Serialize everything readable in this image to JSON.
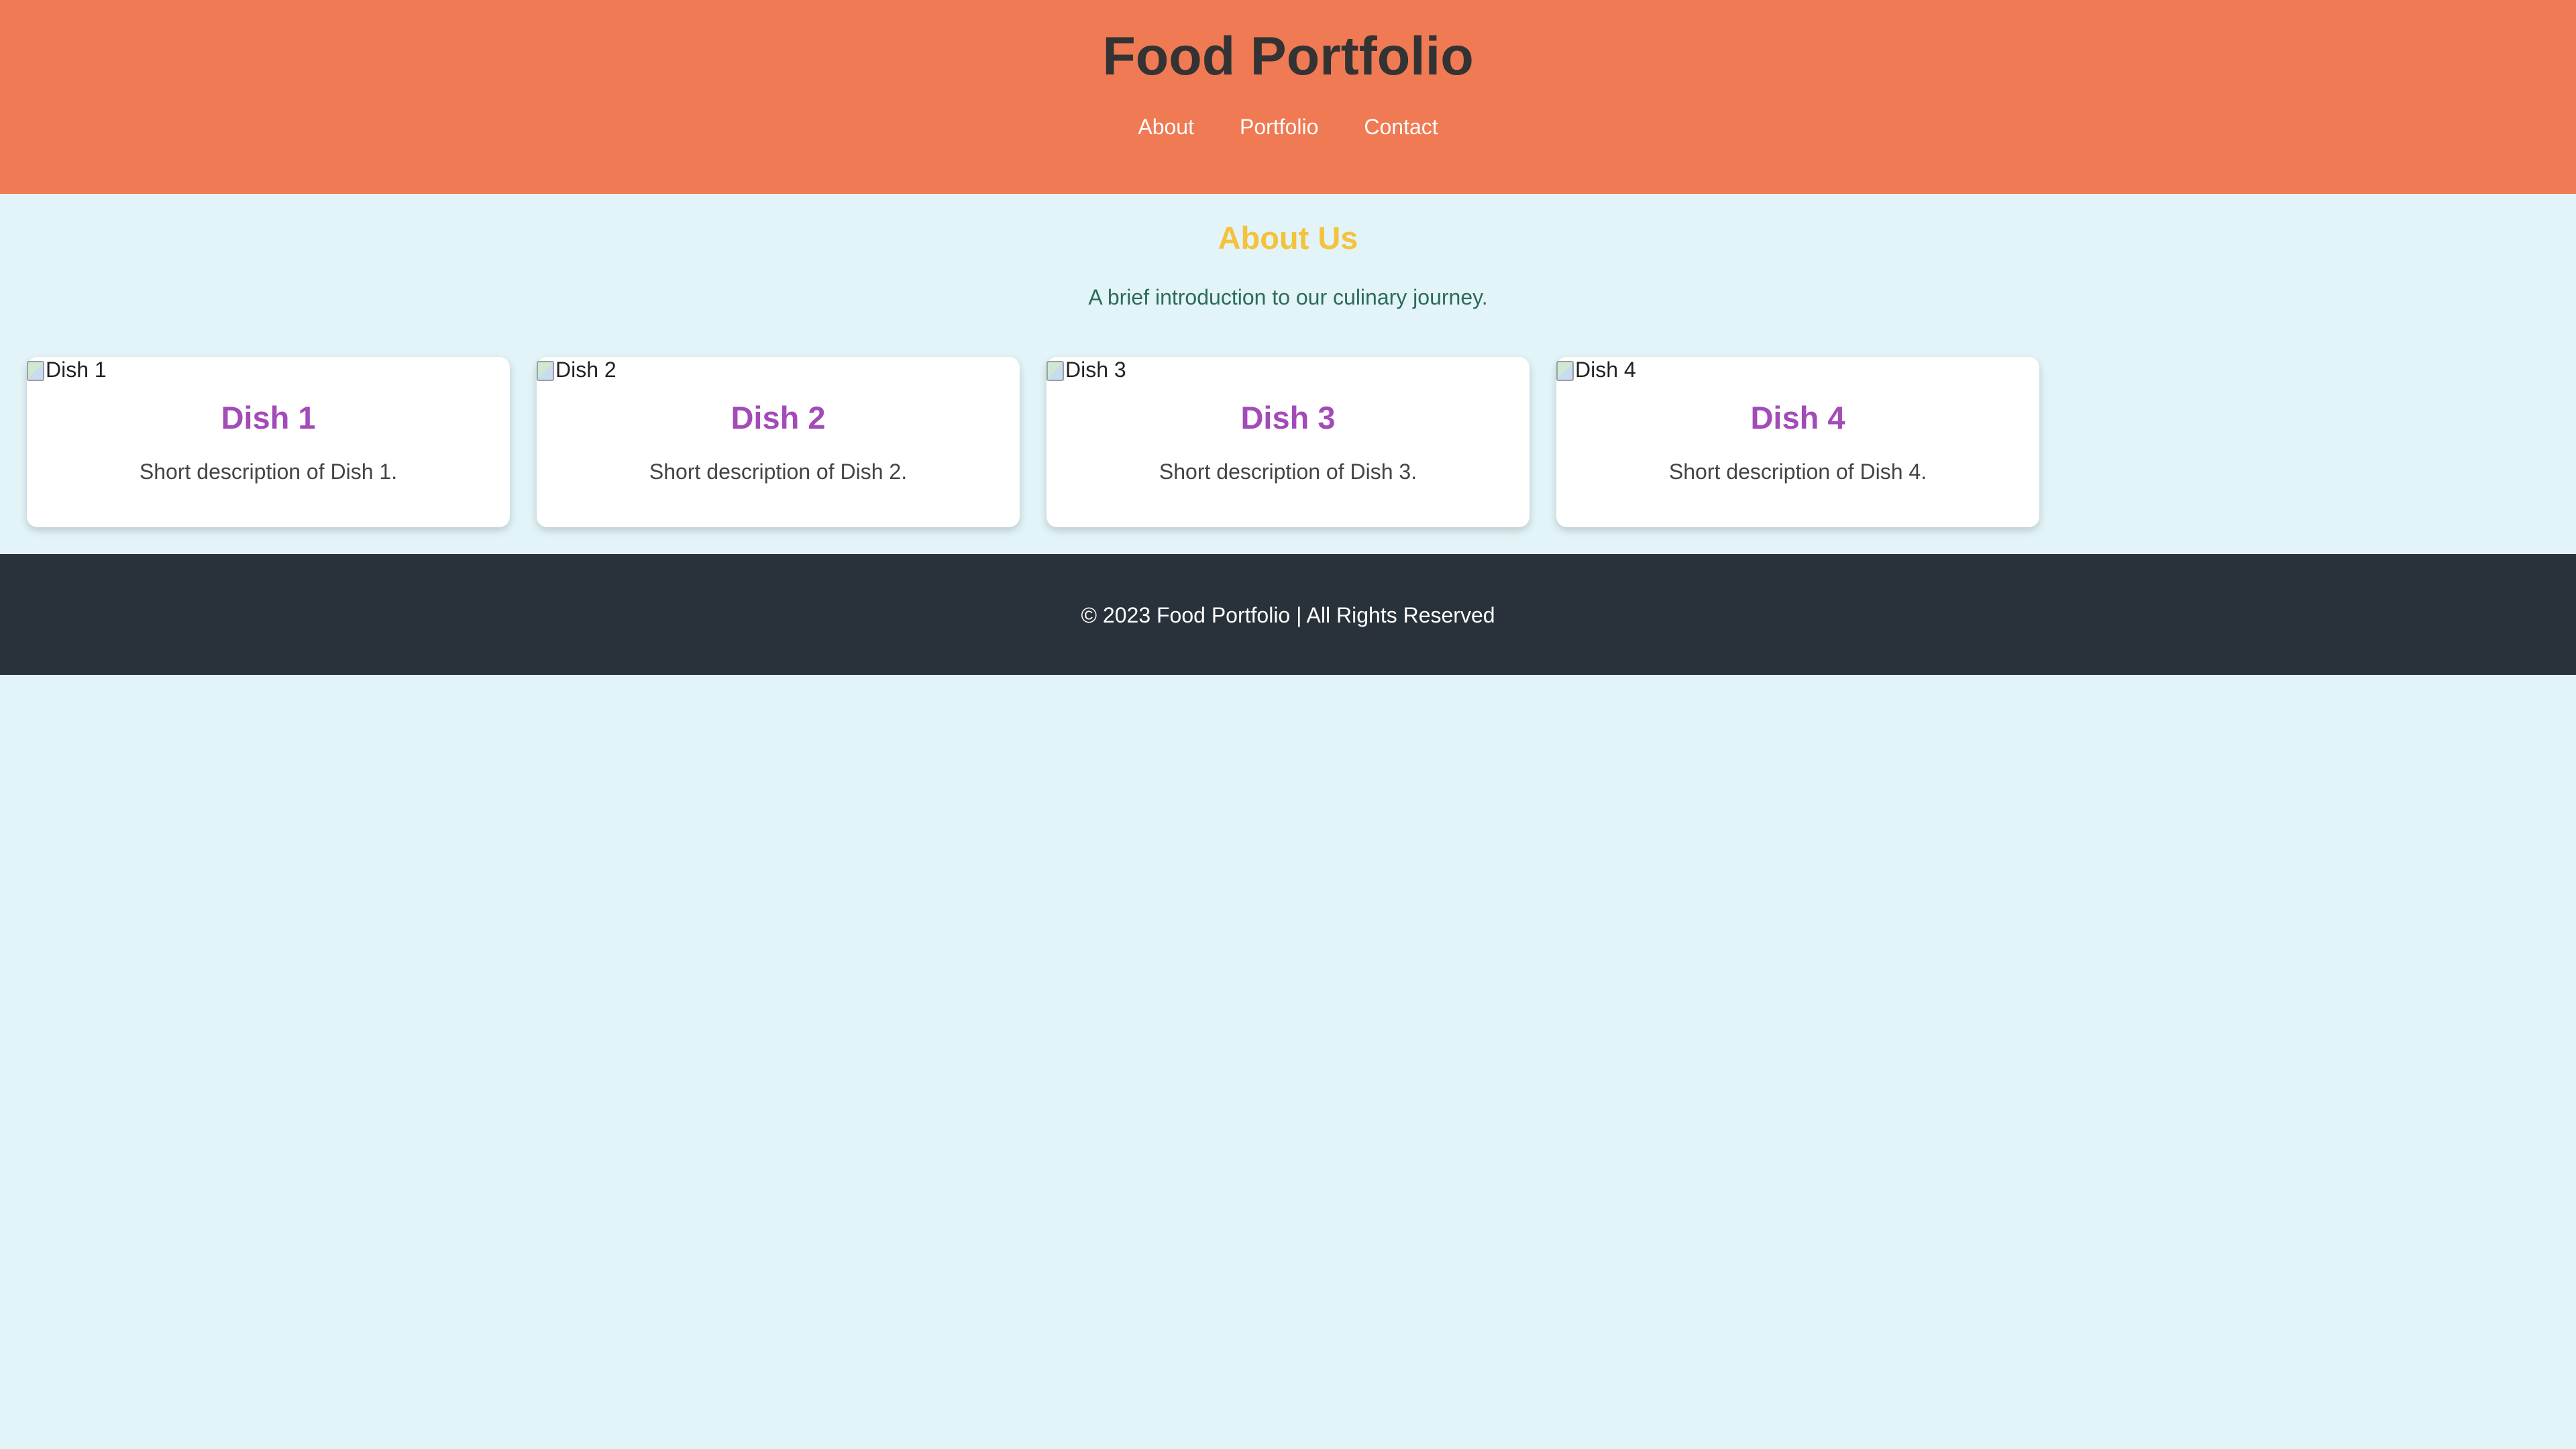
{
  "header": {
    "title": "Food Portfolio",
    "nav": [
      {
        "label": "About"
      },
      {
        "label": "Portfolio"
      },
      {
        "label": "Contact"
      }
    ]
  },
  "about": {
    "heading": "About Us",
    "text": "A brief introduction to our culinary journey."
  },
  "portfolio": {
    "dishes": [
      {
        "image_alt": "Dish 1",
        "title": "Dish 1",
        "description": "Short description of Dish 1."
      },
      {
        "image_alt": "Dish 2",
        "title": "Dish 2",
        "description": "Short description of Dish 2."
      },
      {
        "image_alt": "Dish 3",
        "title": "Dish 3",
        "description": "Short description of Dish 3."
      },
      {
        "image_alt": "Dish 4",
        "title": "Dish 4",
        "description": "Short description of Dish 4."
      }
    ]
  },
  "footer": {
    "text": "© 2023 Food Portfolio | All Rights Reserved"
  },
  "colors": {
    "header_bg": "#ef7a53",
    "page_bg": "#e2f4f8",
    "about_heading": "#f4c23c",
    "about_text": "#2b6b5b",
    "dish_title": "#a34bb8",
    "footer_bg": "#29323a"
  }
}
